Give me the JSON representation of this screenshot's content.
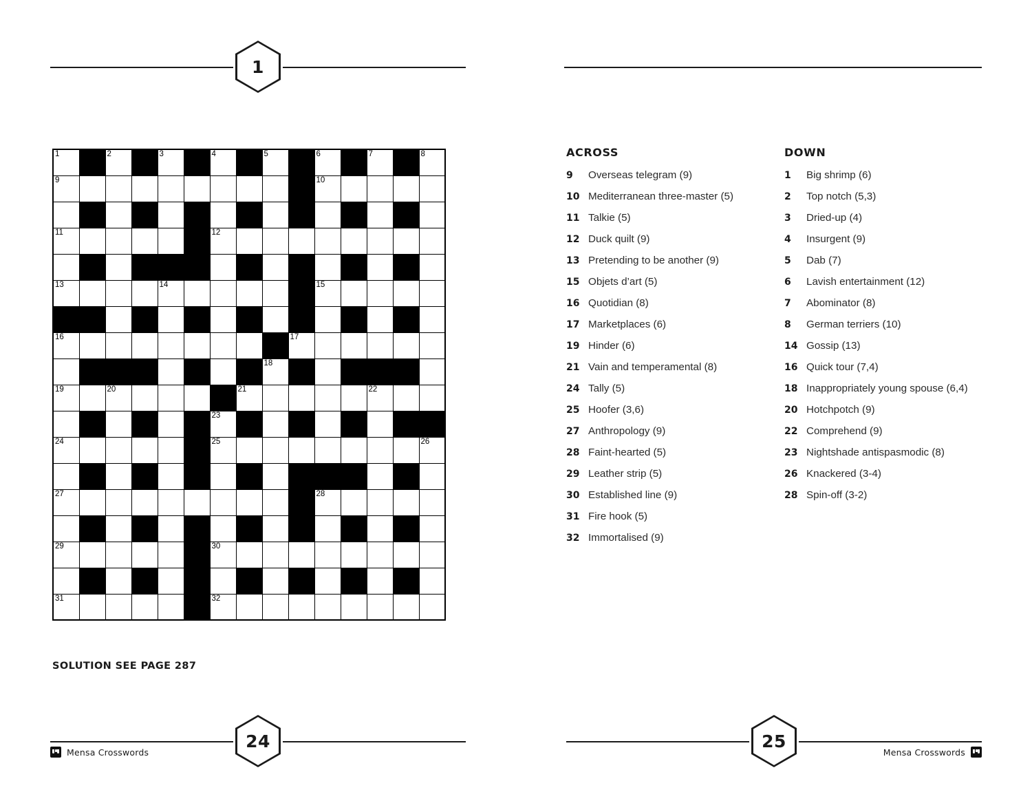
{
  "puzzle": {
    "number": "1",
    "solution_note": "SOLUTION SEE PAGE 287"
  },
  "clues": {
    "across_heading": "ACROSS",
    "down_heading": "DOWN",
    "across": [
      {
        "num": "9",
        "text": "Overseas telegram (9)"
      },
      {
        "num": "10",
        "text": "Mediterranean three-master (5)"
      },
      {
        "num": "11",
        "text": "Talkie (5)"
      },
      {
        "num": "12",
        "text": "Duck quilt (9)"
      },
      {
        "num": "13",
        "text": "Pretending to be another (9)"
      },
      {
        "num": "15",
        "text": "Objets d’art (5)"
      },
      {
        "num": "16",
        "text": "Quotidian (8)"
      },
      {
        "num": "17",
        "text": "Marketplaces (6)"
      },
      {
        "num": "19",
        "text": "Hinder (6)"
      },
      {
        "num": "21",
        "text": "Vain and temperamental (8)"
      },
      {
        "num": "24",
        "text": "Tally (5)"
      },
      {
        "num": "25",
        "text": "Hoofer (3,6)"
      },
      {
        "num": "27",
        "text": "Anthropology (9)"
      },
      {
        "num": "28",
        "text": "Faint-hearted (5)"
      },
      {
        "num": "29",
        "text": "Leather strip (5)"
      },
      {
        "num": "30",
        "text": "Established line (9)"
      },
      {
        "num": "31",
        "text": "Fire hook (5)"
      },
      {
        "num": "32",
        "text": "Immortalised (9)"
      }
    ],
    "down": [
      {
        "num": "1",
        "text": "Big shrimp (6)"
      },
      {
        "num": "2",
        "text": "Top notch (5,3)"
      },
      {
        "num": "3",
        "text": "Dried-up (4)"
      },
      {
        "num": "4",
        "text": "Insurgent (9)"
      },
      {
        "num": "5",
        "text": "Dab (7)"
      },
      {
        "num": "6",
        "text": "Lavish entertainment (12)"
      },
      {
        "num": "7",
        "text": "Abominator (8)"
      },
      {
        "num": "8",
        "text": "German terriers (10)"
      },
      {
        "num": "14",
        "text": "Gossip (13)"
      },
      {
        "num": "16",
        "text": "Quick tour (7,4)"
      },
      {
        "num": "18",
        "text": "Inappropriately young spouse (6,4)"
      },
      {
        "num": "20",
        "text": "Hotchpotch (9)"
      },
      {
        "num": "22",
        "text": "Comprehend (9)"
      },
      {
        "num": "23",
        "text": "Nightshade antispasmodic (8)"
      },
      {
        "num": "26",
        "text": "Knackered (3-4)"
      },
      {
        "num": "28",
        "text": "Spin-off (3-2)"
      }
    ]
  },
  "grid": {
    "rows": 18,
    "cols": 15,
    "pattern": [
      "WBWBWBWBWBWBWBW",
      "WWWWWWWWWBWWWWW",
      "WBWBWBWBWBWBWBW",
      "WWWWWBWWWWWWWWW",
      "WBWBBBWBWBWBWBW",
      "WWWWWWWWWBWWWWW",
      "BBWBWBWBWBWBWBW",
      "WWWWWWWWBWWWWWW",
      "WBBBWBWBWBWBBBW",
      "WWWWWWBWWWWWWWW",
      "WBWBWBWBWBWBWBB",
      "WWWWWBWWWWWWWWW",
      "WBWBWBWBWBBBWBW",
      "WWWWWWWWWBWWWWW",
      "WBWBWBWBWBWBWBW",
      "WWWWWBWWWWWWWWW",
      "WBWBWBWBWBWBWBW",
      "WWWWWBWWWWWWWWW"
    ],
    "numbers": [
      {
        "r": 0,
        "c": 0,
        "n": "1"
      },
      {
        "r": 0,
        "c": 2,
        "n": "2"
      },
      {
        "r": 0,
        "c": 4,
        "n": "3"
      },
      {
        "r": 0,
        "c": 6,
        "n": "4"
      },
      {
        "r": 0,
        "c": 8,
        "n": "5"
      },
      {
        "r": 0,
        "c": 10,
        "n": "6"
      },
      {
        "r": 0,
        "c": 12,
        "n": "7"
      },
      {
        "r": 0,
        "c": 14,
        "n": "8"
      },
      {
        "r": 1,
        "c": 0,
        "n": "9"
      },
      {
        "r": 1,
        "c": 10,
        "n": "10"
      },
      {
        "r": 3,
        "c": 0,
        "n": "11"
      },
      {
        "r": 3,
        "c": 6,
        "n": "12"
      },
      {
        "r": 5,
        "c": 0,
        "n": "13"
      },
      {
        "r": 5,
        "c": 4,
        "n": "14"
      },
      {
        "r": 5,
        "c": 10,
        "n": "15"
      },
      {
        "r": 7,
        "c": 0,
        "n": "16"
      },
      {
        "r": 7,
        "c": 9,
        "n": "17"
      },
      {
        "r": 8,
        "c": 8,
        "n": "18"
      },
      {
        "r": 9,
        "c": 0,
        "n": "19"
      },
      {
        "r": 9,
        "c": 2,
        "n": "20"
      },
      {
        "r": 9,
        "c": 7,
        "n": "21"
      },
      {
        "r": 9,
        "c": 12,
        "n": "22"
      },
      {
        "r": 10,
        "c": 6,
        "n": "23"
      },
      {
        "r": 11,
        "c": 0,
        "n": "24"
      },
      {
        "r": 11,
        "c": 6,
        "n": "25"
      },
      {
        "r": 11,
        "c": 14,
        "n": "26"
      },
      {
        "r": 13,
        "c": 0,
        "n": "27"
      },
      {
        "r": 13,
        "c": 10,
        "n": "28"
      },
      {
        "r": 15,
        "c": 0,
        "n": "29"
      },
      {
        "r": 15,
        "c": 6,
        "n": "30"
      },
      {
        "r": 17,
        "c": 0,
        "n": "31"
      },
      {
        "r": 17,
        "c": 6,
        "n": "32"
      }
    ]
  },
  "footer": {
    "left_folio": "24",
    "right_folio": "25",
    "left_colophon": "Mensa Crosswords",
    "right_colophon": "Mensa Crosswords"
  }
}
